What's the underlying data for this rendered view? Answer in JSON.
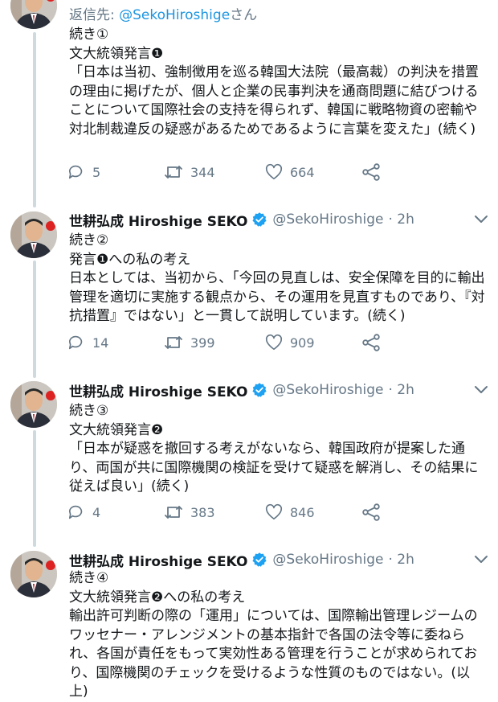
{
  "colors": {
    "link": "#1b95e0",
    "muted": "#657786",
    "text": "#14171a",
    "thread_line": "#cfd9de",
    "verified": "#1da1f2"
  },
  "tweet1": {
    "reply_prefix": "返信先:",
    "reply_handle": "@SekoHiroshige",
    "reply_suffix": "さん",
    "lines": [
      "続き①",
      "文大統領発言❶",
      "「日本は当初、強制徴用を巡る韓国大法院（最高裁）の判決を措置の理由に掲げたが、個人と企業の民事判決を通商問題に結びつけることについて国際社会の支持を得られず、韓国に戦略物資の密輸や対北制裁違反の疑惑があるためであるように言葉を変えた」(続く)"
    ],
    "replies": "5",
    "retweets": "344",
    "likes": "664"
  },
  "tweet2": {
    "name": "世耕弘成 Hiroshige SEKO",
    "handle": "@SekoHiroshige",
    "time": "· 2h",
    "lines": [
      "続き②",
      "発言❶への私の考え",
      "日本としては、当初から、「今回の見直しは、安全保障を目的に輸出管理を適切に実施する観点から、その運用を見直すものであり、『対抗措置』ではない」と一貫して説明しています。(続く)"
    ],
    "replies": "14",
    "retweets": "399",
    "likes": "909"
  },
  "tweet3": {
    "name": "世耕弘成 Hiroshige SEKO",
    "handle": "@SekoHiroshige",
    "time": "· 2h",
    "lines": [
      "続き③",
      "文大統領発言❷",
      "「日本が疑惑を撤回する考えがないなら、韓国政府が提案した通り、両国が共に国際機関の検証を受けて疑惑を解消し、その結果に従えば良い」(続く)"
    ],
    "replies": "4",
    "retweets": "383",
    "likes": "846"
  },
  "tweet4": {
    "name": "世耕弘成 Hiroshige SEKO",
    "handle": "@SekoHiroshige",
    "time": "· 2h",
    "lines": [
      "続き④",
      "文大統領発言❷への私の考え",
      "輸出許可判断の際の「運用」については、国際輸出管理レジームのワッセナー・アレンジメントの基本指針で各国の法令等に委ねられ、各国が責任をもって実効性ある管理を行うことが求められており、国際機関のチェックを受けるような性質のものではない。(以上)"
    ]
  }
}
